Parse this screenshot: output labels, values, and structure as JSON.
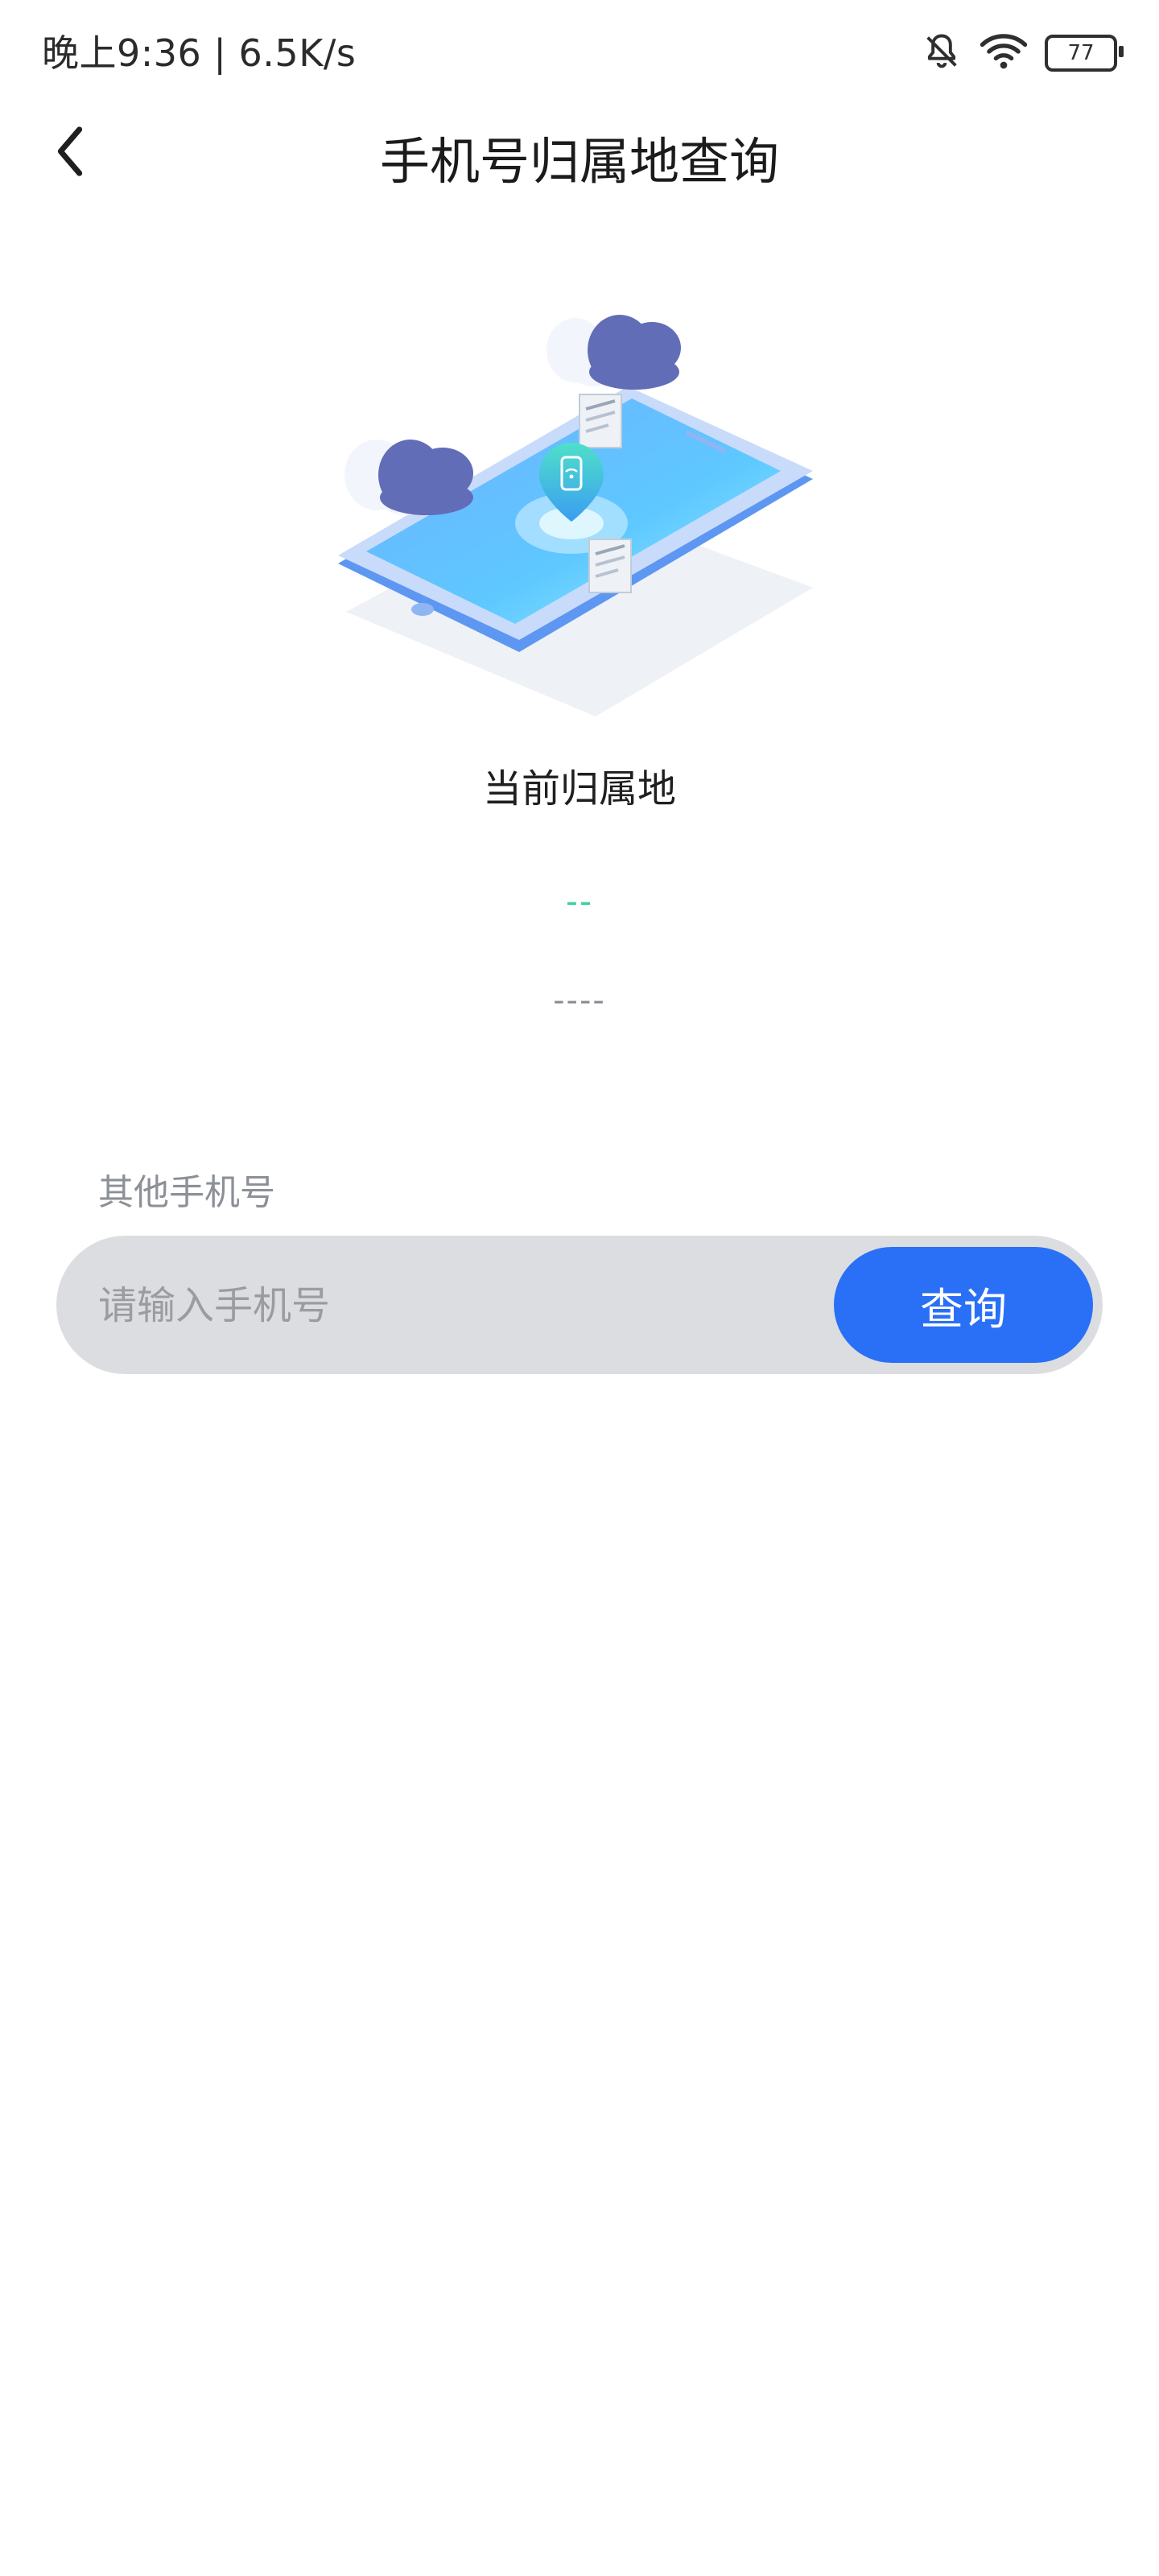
{
  "status_bar": {
    "time_speed": "晚上9:36 | 6.5K/s",
    "battery": "77",
    "icons": [
      "mute-bell-icon",
      "wifi-icon",
      "battery-icon"
    ]
  },
  "header": {
    "back_icon": "chevron-left-icon",
    "title": "手机号归属地查询"
  },
  "current": {
    "label": "当前归属地",
    "region": "--",
    "operator": "----"
  },
  "other": {
    "label": "其他手机号",
    "input_placeholder": "请输入手机号",
    "input_value": "",
    "button_label": "查询"
  },
  "colors": {
    "accent": "#2970f6",
    "region_text": "#39d39a",
    "input_bg": "#dcdde0"
  }
}
